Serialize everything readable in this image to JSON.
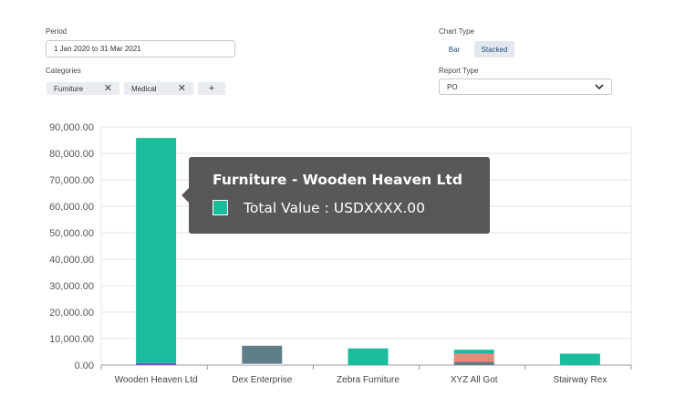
{
  "filters": {
    "period_label": "Period",
    "period_value": "1 Jan 2020 to 31 Mar 2021",
    "categories_label": "Categories",
    "categories": [
      {
        "label": "Furniture"
      },
      {
        "label": "Medical"
      }
    ],
    "add_button": "+"
  },
  "chart_type": {
    "label": "Chart Type",
    "options": [
      "Bar",
      "Stacked"
    ],
    "selected": "Stacked"
  },
  "report_type": {
    "label": "Report Type",
    "value": "PO"
  },
  "tooltip": {
    "title": "Furniture - Wooden Heaven Ltd",
    "text": "Total Value : USDXXXX.00",
    "swatch_color": "#1abc9c"
  },
  "chart_data": {
    "type": "bar",
    "stacked": true,
    "categories": [
      "Wooden Heaven Ltd",
      "Dex Enterprise",
      "Zebra Furniture",
      "XYZ All Got",
      "Stairway Rex"
    ],
    "y_ticks": [
      "0.00",
      "10,000.00",
      "20,000.00",
      "30,000.00",
      "40,000.00",
      "50,000.00",
      "60,000.00",
      "70,000.00",
      "80,000.00",
      "90,000.00"
    ],
    "ylim": [
      0,
      90000
    ],
    "grid": true,
    "series": [
      {
        "color": "#6a5acd",
        "values": [
          800,
          0,
          0,
          0,
          0
        ]
      },
      {
        "color": "#e8e8e8",
        "values": [
          0,
          500,
          0,
          0,
          0
        ]
      },
      {
        "color": "#5f7d87",
        "values": [
          0,
          6800,
          0,
          1200,
          0
        ]
      },
      {
        "color": "#f0857a",
        "values": [
          0,
          0,
          0,
          3000,
          0
        ]
      },
      {
        "color": "#1abc9c",
        "values": [
          85000,
          0,
          6300,
          1600,
          4300
        ]
      }
    ]
  }
}
